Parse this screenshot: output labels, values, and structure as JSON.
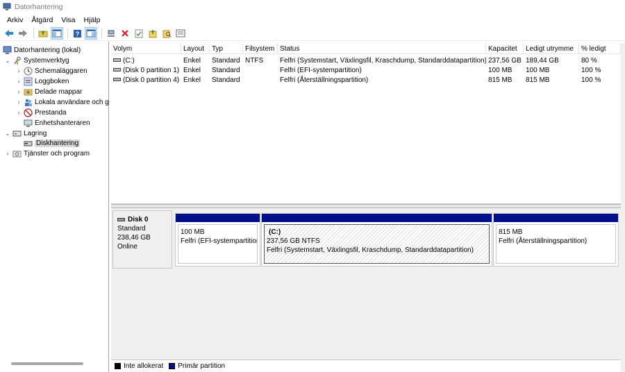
{
  "window": {
    "title": "Datorhantering"
  },
  "menu": [
    "Arkiv",
    "Åtgärd",
    "Visa",
    "Hjälp"
  ],
  "toolbar": [
    "back-icon",
    "forward-icon",
    "folder-up-icon",
    "console-tree-icon",
    "help-icon",
    "show-hide-icon",
    "connect-icon",
    "delete-icon",
    "check-icon",
    "export-icon",
    "search-icon",
    "properties-icon"
  ],
  "tree": {
    "root": "Datorhantering (lokal)",
    "systemverktyg": "Systemverktyg",
    "schemalaggaren": "Schemaläggaren",
    "loggboken": "Loggboken",
    "delade_mappar": "Delade mappar",
    "lokala": "Lokala användare och g",
    "prestanda": "Prestanda",
    "enhetshanteraren": "Enhetshanteraren",
    "lagring": "Lagring",
    "diskhantering": "Diskhantering",
    "tjanster": "Tjänster och program"
  },
  "volumes": {
    "columns": [
      "Volym",
      "Layout",
      "Typ",
      "Filsystem",
      "Status",
      "Kapacitet",
      "Ledigt utrymme",
      "% ledigt"
    ],
    "rows": [
      [
        "(C:)",
        "Enkel",
        "Standard",
        "NTFS",
        "Felfri (Systemstart, Växlingsfil, Kraschdump, Standarddatapartition)",
        "237,56 GB",
        "189,44 GB",
        "80 %"
      ],
      [
        "(Disk 0 partition 1)",
        "Enkel",
        "Standard",
        "",
        "Felfri (EFI-systempartition)",
        "100 MB",
        "100 MB",
        "100 %"
      ],
      [
        "(Disk 0 partition 4)",
        "Enkel",
        "Standard",
        "",
        "Felfri (Återställningspartition)",
        "815 MB",
        "815 MB",
        "100 %"
      ]
    ]
  },
  "disk": {
    "name": "Disk 0",
    "type": "Standard",
    "size": "238,46 GB",
    "status": "Online",
    "partitions": [
      {
        "title": "",
        "size": "100 MB",
        "status": "Felfri (EFI-systempartition)"
      },
      {
        "title": "(C:)",
        "size": "237,56 GB NTFS",
        "status": "Felfri (Systemstart, Växlingsfil, Kraschdump, Standarddatapartition)"
      },
      {
        "title": "",
        "size": "815 MB",
        "status": "Felfri (Återställningspartition)"
      }
    ]
  },
  "legend": {
    "unallocated": "Inte allokerat",
    "primary": "Primär partition"
  },
  "colors": {
    "primary_partition": "#00108a",
    "unallocated": "#000000",
    "selection": "#d9d9d9"
  }
}
